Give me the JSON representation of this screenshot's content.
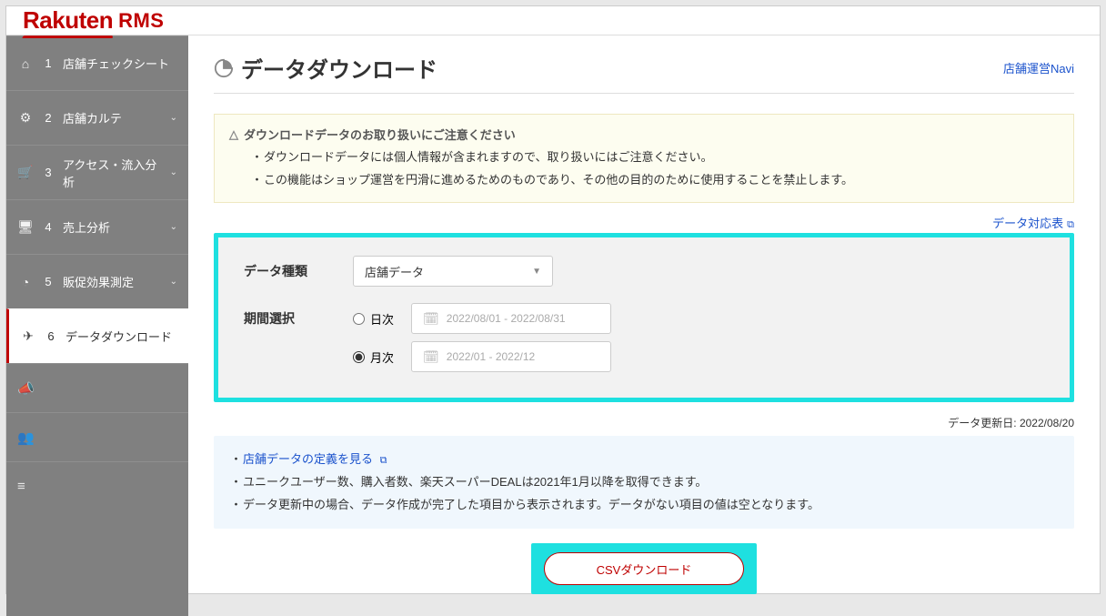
{
  "header": {
    "logo_main": "Rakuten",
    "logo_sub": "RMS"
  },
  "sidebar": {
    "items": [
      {
        "icon": "home-icon",
        "glyph": "⌂",
        "num": "1",
        "label": "店舗チェックシート",
        "expandable": false
      },
      {
        "icon": "gear-icon",
        "glyph": "⚙",
        "num": "2",
        "label": "店舗カルテ",
        "expandable": true
      },
      {
        "icon": "cart-icon",
        "glyph": "🛒",
        "num": "3",
        "label": "アクセス・流入分析",
        "expandable": true
      },
      {
        "icon": "monitor-icon",
        "glyph": "🖥",
        "num": "4",
        "label": "売上分析",
        "expandable": true
      },
      {
        "icon": "pie-icon",
        "glyph": "◔",
        "num": "5",
        "label": "販促効果測定",
        "expandable": true
      },
      {
        "icon": "send-icon",
        "glyph": "✈",
        "num": "6",
        "label": "データダウンロード",
        "expandable": false,
        "active": true
      }
    ],
    "tray": [
      {
        "icon": "megaphone-icon",
        "glyph": "📣"
      },
      {
        "icon": "users-icon",
        "glyph": "👥"
      },
      {
        "icon": "list-icon",
        "glyph": "≡"
      }
    ]
  },
  "page": {
    "title": "データダウンロード",
    "navi_link": "店舗運営Navi",
    "chart_link": "データ対応表"
  },
  "warning": {
    "heading": "ダウンロードデータのお取り扱いにご注意ください",
    "lines": [
      "ダウンロードデータには個人情報が含まれますので、取り扱いにはご注意ください。",
      "この機能はショップ運営を円滑に進めるためのものであり、その他の目的のために使用することを禁止します。"
    ]
  },
  "filters": {
    "data_type_label": "データ種類",
    "data_type_value": "店舗データ",
    "period_label": "期間選択",
    "daily_label": "日次",
    "monthly_label": "月次",
    "daily_range": "2022/08/01 - 2022/08/31",
    "monthly_range": "2022/01 - 2022/12",
    "selected_period": "monthly"
  },
  "updated": {
    "label": "データ更新日:",
    "value": "2022/08/20"
  },
  "info": {
    "link_text": "店舗データの定義を見る",
    "lines": [
      "ユニークユーザー数、購入者数、楽天スーパーDEALは2021年1月以降を取得できます。",
      "データ更新中の場合、データ作成が完了した項目から表示されます。データがない項目の値は空となります。"
    ]
  },
  "download_btn": "CSVダウンロード"
}
